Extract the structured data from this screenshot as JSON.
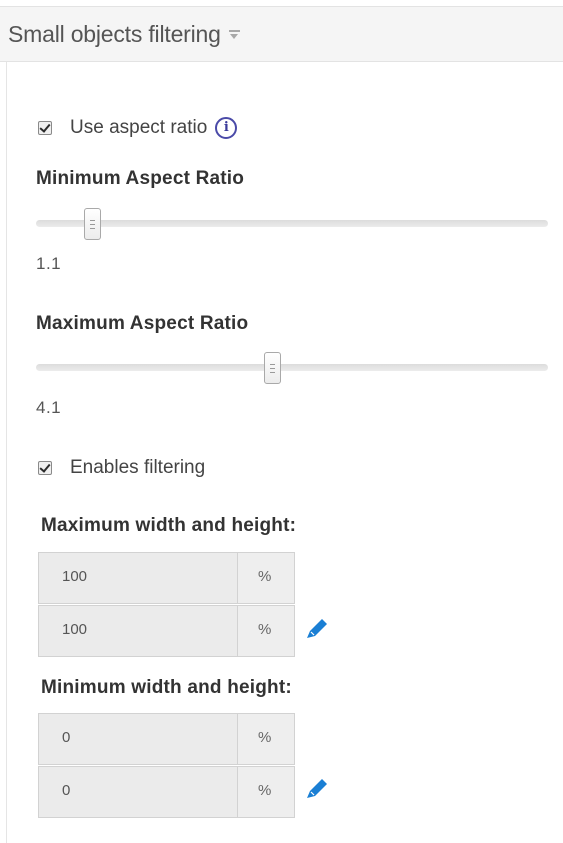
{
  "panel": {
    "title": "Small objects filtering",
    "caret_icon": "caret-down-icon"
  },
  "aspect_ratio": {
    "checkbox_label": "Use aspect ratio",
    "checked": true,
    "info_icon": "info-icon",
    "info_glyph": "i",
    "min": {
      "label": "Minimum Aspect Ratio",
      "value": "1.1",
      "slider_fraction": 0.11
    },
    "max": {
      "label": "Maximum Aspect Ratio",
      "value": "4.1",
      "slider_fraction": 0.46
    }
  },
  "filtering": {
    "checkbox_label": "Enables filtering",
    "checked": true,
    "max_size": {
      "label": "Maximum width and height:",
      "width_value": "100",
      "height_value": "100",
      "unit": "%"
    },
    "min_size": {
      "label": "Minimum width and height:",
      "width_value": "0",
      "height_value": "0",
      "unit": "%"
    },
    "edit_icon": "pencil-icon",
    "edit_icon_color": "#1a7fd4"
  }
}
